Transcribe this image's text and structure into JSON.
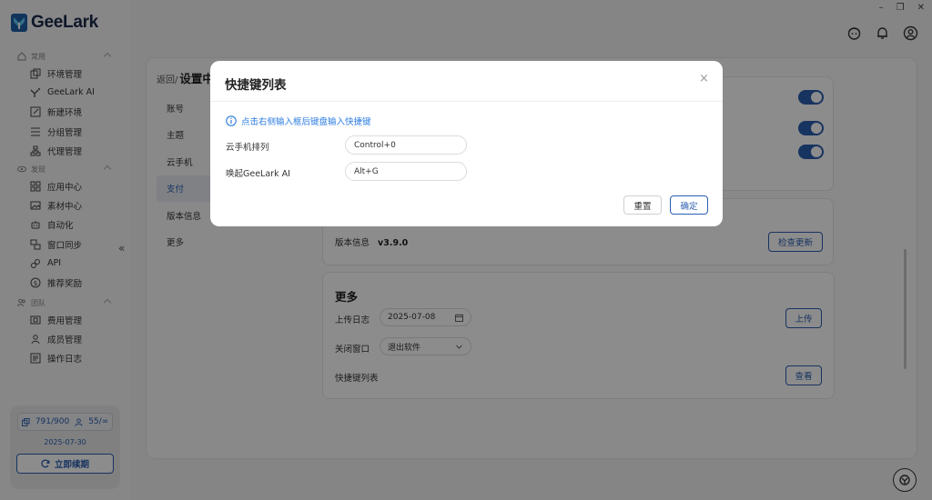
{
  "app": {
    "logo_text": "GeeLark"
  },
  "window": {
    "minimize": "–",
    "restore": "❐",
    "close": "✕"
  },
  "sidebar": {
    "groups": [
      {
        "label": "常用",
        "items": [
          {
            "label": "环境管理",
            "icon": "copy-icon"
          },
          {
            "label": "GeeLark AI",
            "icon": "ai-icon"
          },
          {
            "label": "新建环境",
            "icon": "edit-icon"
          },
          {
            "label": "分组管理",
            "icon": "list-icon"
          },
          {
            "label": "代理管理",
            "icon": "network-icon"
          }
        ]
      },
      {
        "label": "发现",
        "items": [
          {
            "label": "应用中心",
            "icon": "grid-icon"
          },
          {
            "label": "素材中心",
            "icon": "image-icon"
          },
          {
            "label": "自动化",
            "icon": "robot-icon"
          },
          {
            "label": "窗口同步",
            "icon": "sync-icon"
          },
          {
            "label": "API",
            "icon": "api-icon"
          },
          {
            "label": "推荐奖励",
            "icon": "dollar-icon"
          }
        ]
      },
      {
        "label": "团队",
        "items": [
          {
            "label": "费用管理",
            "icon": "bill-icon"
          },
          {
            "label": "成员管理",
            "icon": "user-icon"
          },
          {
            "label": "操作日志",
            "icon": "log-icon"
          }
        ]
      }
    ],
    "collapse_glyph": "«",
    "quota": {
      "envs": "791/900",
      "members": "55/∞",
      "date": "2025-07-30",
      "renew_label": "立即续期"
    }
  },
  "settings": {
    "breadcrumb_back": "返回/",
    "breadcrumb_current": "设置中",
    "menu": [
      "账号",
      "主题",
      "云手机",
      "支付",
      "版本信息",
      "更多"
    ],
    "active_menu_index": 3,
    "version": {
      "label": "版本信息",
      "value": "v3.9.0",
      "check_label": "检查更新"
    },
    "more": {
      "title": "更多",
      "upload_log_label": "上传日志",
      "upload_log_date": "2025-07-08",
      "upload_label": "上传",
      "close_window_label": "关闭窗口",
      "close_window_value": "退出软件",
      "shortcut_list_label": "快捷键列表",
      "view_label": "查看"
    }
  },
  "modal": {
    "title": "快捷键列表",
    "close_glyph": "×",
    "hint": "点击右侧输入框后键盘输入快捷键",
    "shortcuts": [
      {
        "label": "云手机排列",
        "value": "Control+0"
      },
      {
        "label": "唤起GeeLark AI",
        "value": "Alt+G"
      }
    ],
    "reset_label": "重置",
    "ok_label": "确定"
  },
  "colors": {
    "primary": "#2a5db0",
    "hint": "#2a7be0",
    "overlay": "rgba(0,0,0,0.45)"
  }
}
